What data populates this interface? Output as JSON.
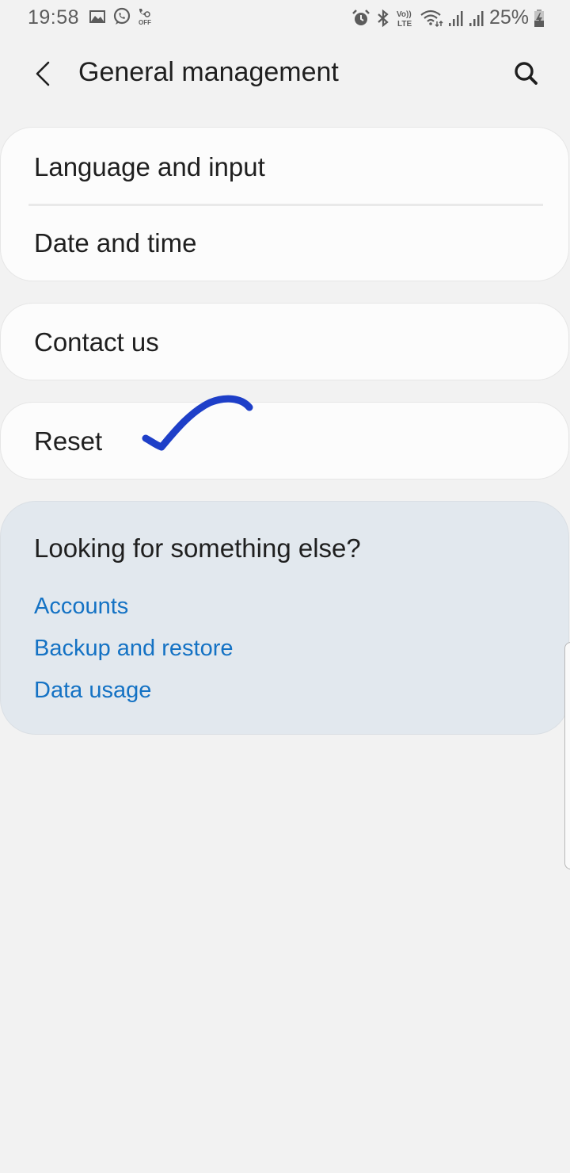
{
  "status_bar": {
    "time": "19:58",
    "left_icons": [
      "gallery-icon",
      "whatsapp-icon",
      "call-auto-off-icon"
    ],
    "right_icons": [
      "alarm-icon",
      "bluetooth-icon",
      "volte-icon",
      "wifi-icon",
      "signal-1-icon",
      "signal-2-icon"
    ],
    "battery_percent": "25%",
    "battery_state": "charging"
  },
  "app_bar": {
    "back_icon": "chevron-left-icon",
    "title": "General management",
    "search_icon": "search-icon"
  },
  "settings_groups": [
    {
      "items": [
        {
          "label": "Language and input"
        },
        {
          "label": "Date and time"
        }
      ]
    },
    {
      "items": [
        {
          "label": "Contact us"
        }
      ]
    },
    {
      "items": [
        {
          "label": "Reset"
        }
      ]
    }
  ],
  "annotation": {
    "type": "hand-drawn-checkmark",
    "color": "#1e3fc8",
    "target": "Reset"
  },
  "suggestions": {
    "title": "Looking for something else?",
    "links": [
      {
        "label": "Accounts"
      },
      {
        "label": "Backup and restore"
      },
      {
        "label": "Data usage"
      }
    ],
    "link_color": "#1472c4"
  }
}
